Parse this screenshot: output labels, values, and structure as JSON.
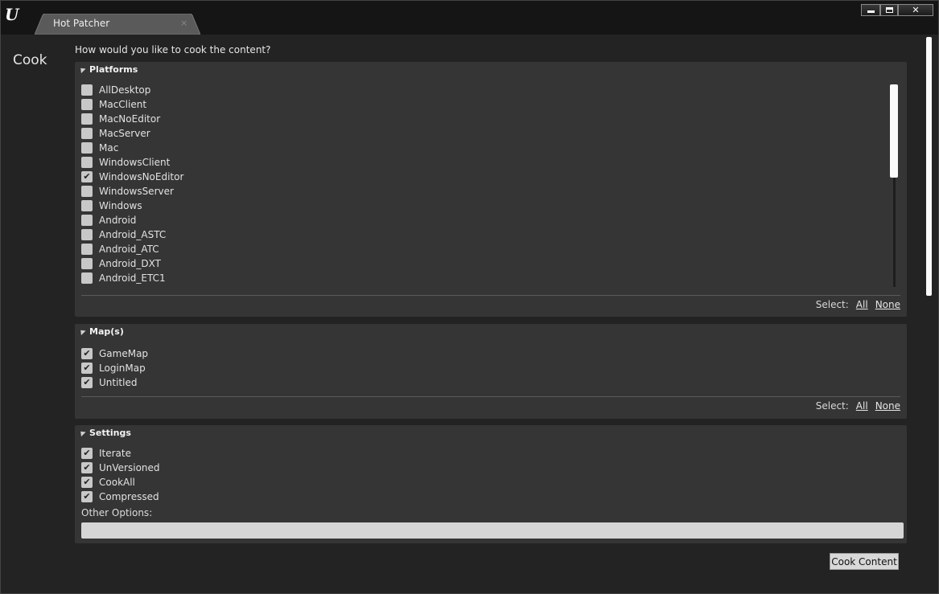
{
  "window": {
    "tab_title": "Hot Patcher",
    "tab_close": "×",
    "close_glyph": "✕"
  },
  "sidebar": {
    "title": "Cook"
  },
  "prompt": "How would you like to cook the content?",
  "platforms": {
    "header": "Platforms",
    "items": [
      {
        "label": "AllDesktop",
        "checked": false
      },
      {
        "label": "MacClient",
        "checked": false
      },
      {
        "label": "MacNoEditor",
        "checked": false
      },
      {
        "label": "MacServer",
        "checked": false
      },
      {
        "label": "Mac",
        "checked": false
      },
      {
        "label": "WindowsClient",
        "checked": false
      },
      {
        "label": "WindowsNoEditor",
        "checked": true
      },
      {
        "label": "WindowsServer",
        "checked": false
      },
      {
        "label": "Windows",
        "checked": false
      },
      {
        "label": "Android",
        "checked": false
      },
      {
        "label": "Android_ASTC",
        "checked": false
      },
      {
        "label": "Android_ATC",
        "checked": false
      },
      {
        "label": "Android_DXT",
        "checked": false
      },
      {
        "label": "Android_ETC1",
        "checked": false
      }
    ],
    "select_label": "Select:",
    "select_all": "All",
    "select_none": "None"
  },
  "maps": {
    "header": "Map(s)",
    "items": [
      {
        "label": "GameMap",
        "checked": true
      },
      {
        "label": "LoginMap",
        "checked": true
      },
      {
        "label": "Untitled",
        "checked": true
      }
    ],
    "select_label": "Select:",
    "select_all": "All",
    "select_none": "None"
  },
  "settings": {
    "header": "Settings",
    "items": [
      {
        "label": "Iterate",
        "checked": true
      },
      {
        "label": "UnVersioned",
        "checked": true
      },
      {
        "label": "CookAll",
        "checked": true
      },
      {
        "label": "Compressed",
        "checked": true
      }
    ],
    "other_options_label": "Other Options:",
    "other_options_value": ""
  },
  "cook_button": "Cook Content",
  "check_glyph": "✔"
}
